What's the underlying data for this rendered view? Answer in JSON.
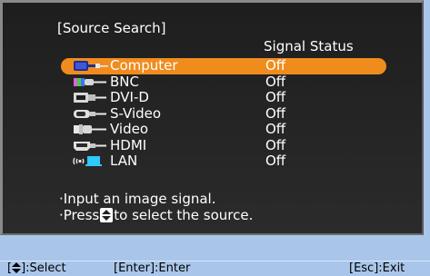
{
  "menu": {
    "title": "[Source Search]",
    "column_header": "Signal Status",
    "sources": [
      {
        "label": "Computer",
        "status": "Off",
        "icon": "computer-icon",
        "selected": true
      },
      {
        "label": "BNC",
        "status": "Off",
        "icon": "bnc-icon",
        "selected": false
      },
      {
        "label": "DVI-D",
        "status": "Off",
        "icon": "dvi-icon",
        "selected": false
      },
      {
        "label": "S-Video",
        "status": "Off",
        "icon": "s-video-icon",
        "selected": false
      },
      {
        "label": "Video",
        "status": "Off",
        "icon": "video-icon",
        "selected": false
      },
      {
        "label": "HDMI",
        "status": "Off",
        "icon": "hdmi-icon",
        "selected": false
      },
      {
        "label": "LAN",
        "status": "Off",
        "icon": "lan-icon",
        "selected": false
      }
    ],
    "hint_line1": "·Input an image signal.",
    "hint_line2_before": "·Press",
    "hint_line2_after": "to select the source."
  },
  "footer": {
    "select_label": "]:Select",
    "enter_label": "[Enter]:Enter",
    "exit_label": "[Esc]:Exit"
  },
  "colors": {
    "highlight": "#f08c1e",
    "panel": "#262626",
    "footer_bg": "#a9c6ea"
  }
}
